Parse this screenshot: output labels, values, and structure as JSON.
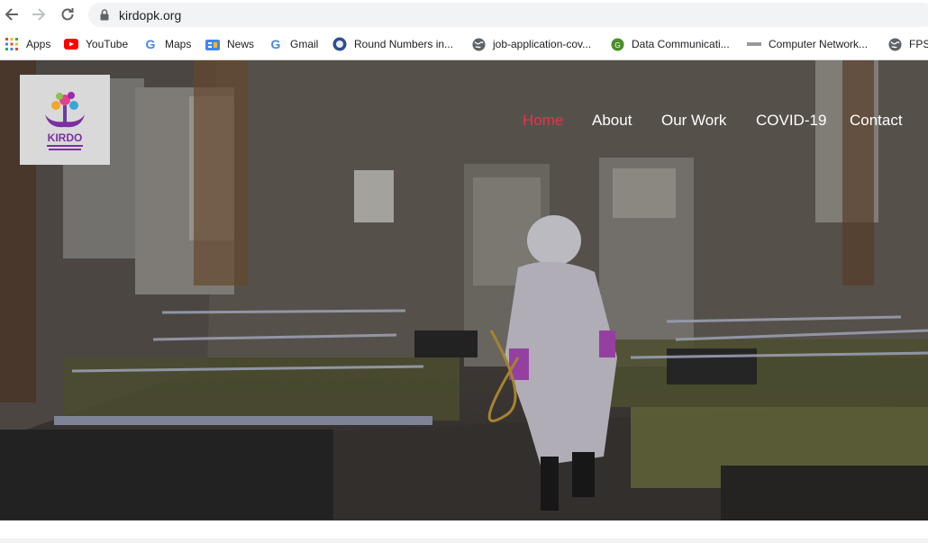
{
  "browser": {
    "url": "kirdopk.org",
    "bookmarks": [
      {
        "label": "Apps",
        "icon": "apps-grid-icon"
      },
      {
        "label": "YouTube",
        "icon": "youtube-icon"
      },
      {
        "label": "Maps",
        "icon": "google-icon"
      },
      {
        "label": "News",
        "icon": "news-icon"
      },
      {
        "label": "Gmail",
        "icon": "google-icon"
      },
      {
        "label": "Round Numbers in...",
        "icon": "globe-seal-icon"
      },
      {
        "label": "job-application-cov...",
        "icon": "globe-icon"
      },
      {
        "label": "Data Communicati...",
        "icon": "green-circle-icon"
      },
      {
        "label": "Computer Network...",
        "icon": "tutorials-icon"
      },
      {
        "label": "FPSC",
        "icon": "globe-icon"
      }
    ]
  },
  "site": {
    "logo_text": "KIRDO",
    "nav": [
      {
        "label": "Home",
        "active": true
      },
      {
        "label": "About",
        "active": false
      },
      {
        "label": "Our Work",
        "active": false
      },
      {
        "label": "COVID-19",
        "active": false
      },
      {
        "label": "Contact",
        "active": false
      }
    ],
    "accent_color": "#e8334a",
    "nav_color": "#ffffff"
  }
}
